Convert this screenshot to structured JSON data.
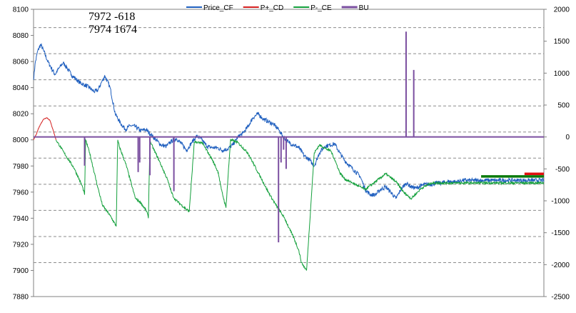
{
  "chart_data": {
    "type": "line",
    "title": "",
    "xlabel": "",
    "ylabel": "",
    "ylim_left": [
      7880,
      8100
    ],
    "ylim_right": [
      -2500,
      2000
    ],
    "yticks_left": [
      7880,
      7900,
      7920,
      7940,
      7960,
      7980,
      8000,
      8020,
      8040,
      8060,
      8080,
      8100
    ],
    "yticks_right": [
      -2500,
      -2000,
      -1500,
      -1000,
      -500,
      0,
      500,
      1000,
      1500,
      2000
    ],
    "gridlines_left": [
      7906,
      7926,
      7946,
      7966,
      7986,
      8006,
      8026,
      8046,
      8066,
      8086
    ],
    "grid": true,
    "legend_position": "top",
    "annotations": [
      {
        "text": "7972   -618"
      },
      {
        "text": "7974   1674"
      }
    ],
    "series": [
      {
        "name": "Price_CF",
        "axis": "left",
        "color": "#1f5fbf",
        "x": [
          0,
          3,
          8,
          14,
          20,
          28,
          35,
          42,
          50,
          58,
          66,
          74,
          82,
          90,
          100,
          110,
          118,
          126,
          133,
          140,
          150,
          160,
          170,
          180,
          190,
          200,
          210,
          220,
          230,
          240,
          250,
          260,
          270,
          280,
          290,
          300,
          310,
          320,
          330,
          340,
          350,
          360,
          370,
          380,
          390,
          400,
          410,
          420,
          430,
          440,
          450,
          460,
          470,
          480,
          490,
          500,
          510,
          520,
          530,
          540,
          550,
          560,
          570,
          580,
          590,
          600,
          610,
          620,
          630,
          640,
          650,
          660,
          670,
          680,
          690,
          700,
          710,
          720,
          730,
          740,
          750,
          760,
          770,
          780,
          790,
          800,
          810,
          820,
          830,
          840,
          850,
          860,
          870,
          880,
          890,
          900,
          910,
          920,
          930,
          940,
          950,
          960,
          970,
          980,
          990,
          1000
        ],
        "values": [
          8046,
          8058,
          8068,
          8073,
          8068,
          8060,
          8055,
          8050,
          8055,
          8059,
          8055,
          8050,
          8047,
          8044,
          8042,
          8040,
          8037,
          8038,
          8044,
          8049,
          8040,
          8020,
          8013,
          8008,
          8011,
          8010,
          8007,
          8008,
          8004,
          8000,
          7996,
          7995,
          7999,
          8001,
          7997,
          7992,
          7998,
          8003,
          8000,
          7995,
          7994,
          7994,
          7992,
          7993,
          7996,
          8002,
          8005,
          8010,
          8017,
          8020,
          8016,
          8014,
          8012,
          8008,
          8002,
          7998,
          7996,
          7994,
          7988,
          7985,
          7980,
          7990,
          7995,
          7996,
          7997,
          7990,
          7984,
          7980,
          7976,
          7972,
          7962,
          7958,
          7958,
          7962,
          7964,
          7960,
          7955,
          7962,
          7967,
          7964,
          7963,
          7965,
          7966,
          7966,
          7967,
          7967,
          7968,
          7968,
          7968,
          7969,
          7969,
          7969,
          7969,
          7969,
          7969,
          7969,
          7969,
          7969,
          7969,
          7969,
          7969,
          7969,
          7969,
          7969,
          7969,
          7969
        ]
      },
      {
        "name": "P+_CD",
        "axis": "left",
        "color": "#d42020",
        "x": [
          0,
          5,
          10,
          15,
          20,
          26,
          32,
          38,
          44
        ],
        "values": [
          8000,
          8004,
          8009,
          8013,
          8016,
          8017,
          8015,
          8008,
          8000
        ]
      },
      {
        "name": "P-_CE",
        "axis": "left",
        "color": "#14a03c",
        "x": [
          44,
          60,
          80,
          96,
          100,
          102,
          110,
          125,
          135,
          150,
          162,
          165,
          168,
          182,
          196,
          200,
          210,
          222,
          225,
          228,
          245,
          262,
          270,
          276,
          290,
          305,
          315,
          330,
          350,
          362,
          368,
          377,
          386,
          400,
          420,
          440,
          460,
          475,
          492,
          500,
          510,
          520,
          525,
          535,
          550,
          560,
          570,
          578,
          582,
          590,
          600,
          610,
          630,
          650,
          670,
          690,
          710,
          725,
          740,
          760,
          780,
          800,
          830,
          850,
          870,
          890,
          910,
          930,
          950,
          970,
          990,
          1000
        ],
        "values": [
          8000,
          7990,
          7978,
          7964,
          7958,
          8000,
          7990,
          7965,
          7950,
          7942,
          7934,
          8000,
          7995,
          7980,
          7960,
          7955,
          7952,
          7945,
          7940,
          7999,
          7985,
          7970,
          7960,
          7955,
          7950,
          7945,
          7998,
          7998,
          7985,
          7975,
          7962,
          7948,
          8000,
          7998,
          7990,
          7975,
          7960,
          7950,
          7940,
          7933,
          7925,
          7915,
          7906,
          7900,
          7990,
          7996,
          7994,
          7992,
          7992,
          7985,
          7975,
          7970,
          7966,
          7962,
          7968,
          7974,
          7968,
          7960,
          7955,
          7963,
          7967,
          7967,
          7967,
          7967,
          7967,
          7967,
          7967,
          7967,
          7967,
          7967,
          7967,
          7967
        ]
      },
      {
        "name": "BU",
        "axis": "right",
        "color": "#7b4fa0",
        "x": [
          100,
          205,
          208,
          228,
          275,
          480,
          485,
          490,
          495,
          730,
          745
        ],
        "values": [
          -450,
          -550,
          -400,
          -600,
          -850,
          -1650,
          -400,
          -200,
          -500,
          1650,
          1050
        ]
      }
    ],
    "levels": [
      {
        "value": 7974,
        "axis": "left",
        "color": "#e01010",
        "x_from": 962,
        "x_to": 1000
      },
      {
        "value": 7972,
        "axis": "left",
        "color": "#0a7a0a",
        "x_from": 877,
        "x_to": 1000
      }
    ]
  }
}
